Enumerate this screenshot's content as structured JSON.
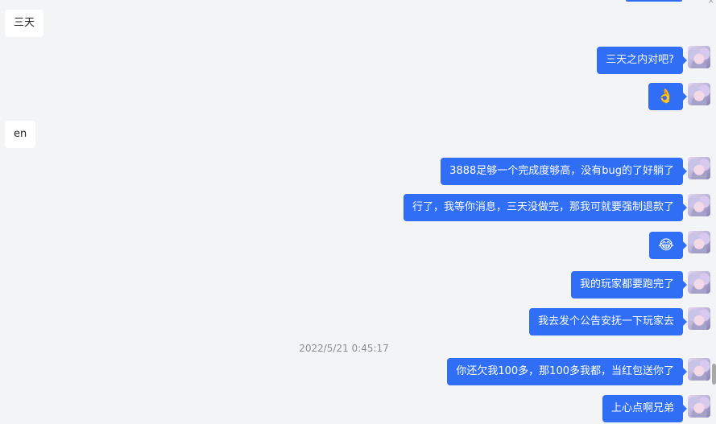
{
  "messages": [
    {
      "side": "left",
      "text": "三天"
    },
    {
      "side": "right",
      "text": "三天之内对吧?"
    },
    {
      "side": "right",
      "text": "👌",
      "emoji": true
    },
    {
      "side": "left",
      "text": "en"
    },
    {
      "side": "right",
      "text": "3888足够一个完成度够高，没有bug的了好躺了"
    },
    {
      "side": "right",
      "text": "行了，我等你消息，三天没做完，那我可就要强制退款了"
    },
    {
      "side": "right",
      "text": "😂",
      "emoji": true
    },
    {
      "side": "right",
      "text": "我的玩家都要跑完了"
    },
    {
      "side": "right",
      "text": "我去发个公告安抚一下玩家去"
    },
    {
      "side": "right",
      "text": "你还欠我100多，那100多我都，当红包送你了"
    },
    {
      "side": "right",
      "text": "上心点啊兄弟"
    }
  ],
  "timestamp": "2022/5/21 0:45:17",
  "close_glyph": "×",
  "colors": {
    "bubble_self": "#2f6ef5",
    "bubble_other": "#ffffff",
    "background": "#f3f4f6"
  }
}
